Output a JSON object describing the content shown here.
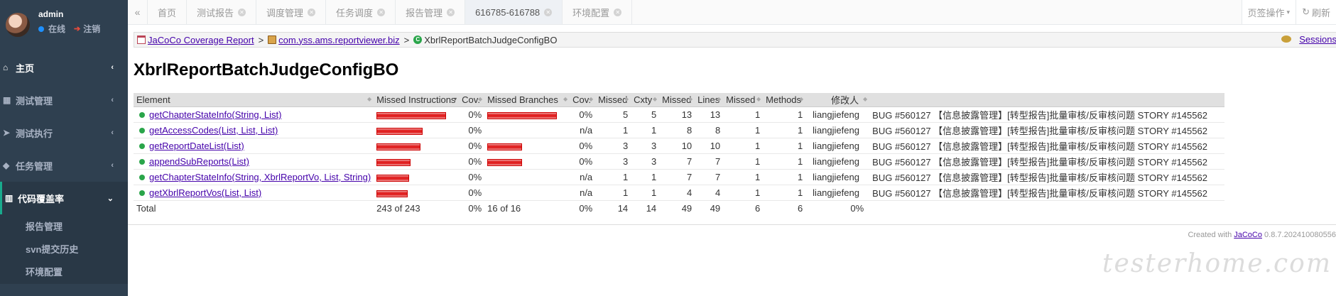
{
  "sidebar": {
    "user": "admin",
    "status": "在线",
    "logout": "注销",
    "items": [
      {
        "label": "主页",
        "icon": "home-icon"
      },
      {
        "label": "测试管理",
        "icon": "grid-icon"
      },
      {
        "label": "测试执行",
        "icon": "send-icon"
      },
      {
        "label": "任务管理",
        "icon": "tag-icon"
      },
      {
        "label": "代码覆盖率",
        "icon": "chart-icon"
      }
    ],
    "subitems": [
      "报告管理",
      "svn提交历史",
      "环境配置"
    ]
  },
  "tabs": [
    {
      "label": "首页",
      "closable": false
    },
    {
      "label": "测试报告",
      "closable": true
    },
    {
      "label": "调度管理",
      "closable": true
    },
    {
      "label": "任务调度",
      "closable": true
    },
    {
      "label": "报告管理",
      "closable": true
    },
    {
      "label": "616785-616788",
      "closable": true,
      "active": true
    },
    {
      "label": "环境配置",
      "closable": true
    }
  ],
  "toolbar": {
    "page_ops": "页签操作",
    "refresh": "刷新"
  },
  "breadcrumb": {
    "report": "JaCoCo Coverage Report",
    "package": "com.yss.ams.reportviewer.biz",
    "class": "XbrlReportBatchJudgeConfigBO",
    "sessions": "Sessions"
  },
  "page_title": "XbrlReportBatchJudgeConfigBO",
  "table": {
    "headers": [
      "Element",
      "Missed Instructions",
      "Cov.",
      "Missed Branches",
      "Cov.",
      "Missed",
      "Cxty",
      "Missed",
      "Lines",
      "Missed",
      "Methods",
      "修改人",
      ""
    ],
    "rows": [
      {
        "element": "getChapterStateInfo(String, List)",
        "instr_missed_pct": 100,
        "instr_cov": "0%",
        "branch_missed_pct": 100,
        "branch_cov": "0%",
        "cxty_missed": "5",
        "cxty": "5",
        "lines_missed": "13",
        "lines": "13",
        "methods_missed": "1",
        "methods": "1",
        "author": "liangjiefeng",
        "commit": "BUG #560127 【信息披露管理】[转型报告]批量审核/反审核问题 STORY #145562"
      },
      {
        "element": "getAccessCodes(List, List, List)",
        "instr_missed_pct": 66,
        "instr_cov": "0%",
        "branch_missed_pct": 0,
        "branch_cov": "n/a",
        "cxty_missed": "1",
        "cxty": "1",
        "lines_missed": "8",
        "lines": "8",
        "methods_missed": "1",
        "methods": "1",
        "author": "liangjiefeng",
        "commit": "BUG #560127 【信息披露管理】[转型报告]批量审核/反审核问题 STORY #145562"
      },
      {
        "element": "getReportDateList(List)",
        "instr_missed_pct": 63,
        "instr_cov": "0%",
        "branch_missed_pct": 50,
        "branch_cov": "0%",
        "cxty_missed": "3",
        "cxty": "3",
        "lines_missed": "10",
        "lines": "10",
        "methods_missed": "1",
        "methods": "1",
        "author": "liangjiefeng",
        "commit": "BUG #560127 【信息披露管理】[转型报告]批量审核/反审核问题 STORY #145562"
      },
      {
        "element": "appendSubReports(List)",
        "instr_missed_pct": 49,
        "instr_cov": "0%",
        "branch_missed_pct": 50,
        "branch_cov": "0%",
        "cxty_missed": "3",
        "cxty": "3",
        "lines_missed": "7",
        "lines": "7",
        "methods_missed": "1",
        "methods": "1",
        "author": "liangjiefeng",
        "commit": "BUG #560127 【信息披露管理】[转型报告]批量审核/反审核问题 STORY #145562"
      },
      {
        "element": "getChapterStateInfo(String, XbrlReportVo, List, String)",
        "instr_missed_pct": 47,
        "instr_cov": "0%",
        "branch_missed_pct": 0,
        "branch_cov": "n/a",
        "cxty_missed": "1",
        "cxty": "1",
        "lines_missed": "7",
        "lines": "7",
        "methods_missed": "1",
        "methods": "1",
        "author": "liangjiefeng",
        "commit": "BUG #560127 【信息披露管理】[转型报告]批量审核/反审核问题 STORY #145562"
      },
      {
        "element": "getXbrlReportVos(List, List)",
        "instr_missed_pct": 45,
        "instr_cov": "0%",
        "branch_missed_pct": 0,
        "branch_cov": "n/a",
        "cxty_missed": "1",
        "cxty": "1",
        "lines_missed": "4",
        "lines": "4",
        "methods_missed": "1",
        "methods": "1",
        "author": "liangjiefeng",
        "commit": "BUG #560127 【信息披露管理】[转型报告]批量审核/反审核问题 STORY #145562"
      }
    ],
    "total": {
      "label": "Total",
      "instr": "243 of 243",
      "instr_cov": "0%",
      "branch": "16 of 16",
      "branch_cov": "0%",
      "cxty_missed": "14",
      "cxty": "14",
      "lines_missed": "49",
      "lines": "49",
      "methods_missed": "6",
      "methods": "6",
      "extra_cov": "0%"
    }
  },
  "footer": {
    "prefix": "Created with ",
    "link": "JaCoCo",
    "version": " 0.8.7.202410080556"
  },
  "watermark": "testerhome.com"
}
